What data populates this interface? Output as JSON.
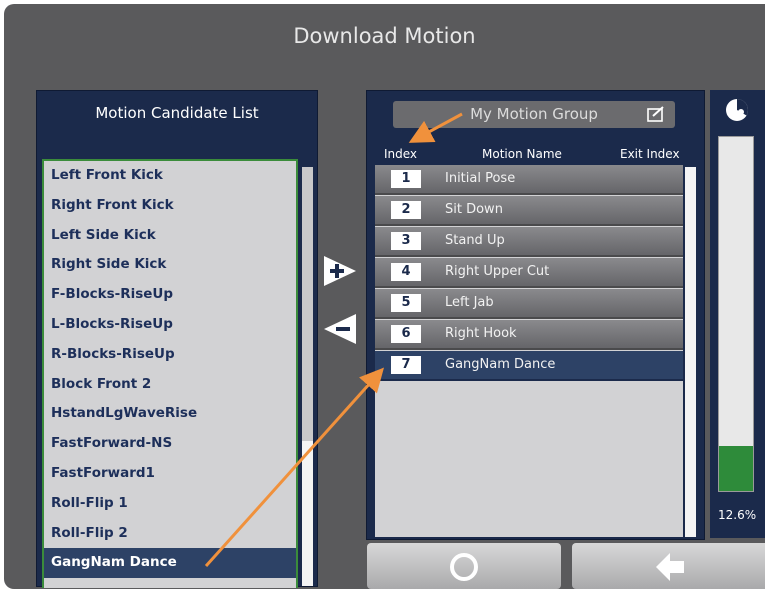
{
  "window": {
    "title": "Download Motion"
  },
  "candidate_panel": {
    "title": "Motion Candidate List",
    "items": [
      "Left Front Kick",
      "Right Front Kick",
      "Left Side Kick",
      "Right Side Kick",
      "F-Blocks-RiseUp",
      "L-Blocks-RiseUp",
      "R-Blocks-RiseUp",
      "Block Front 2",
      "HstandLgWaveRise",
      "FastForward-NS",
      "FastForward1",
      "Roll-Flip 1",
      "Roll-Flip 2",
      "GangNam Dance"
    ],
    "selected_index": 13
  },
  "transfer": {
    "add_icon": "plus-chevron-icon",
    "remove_icon": "minus-chevron-icon"
  },
  "group_panel": {
    "button_label": "My Motion Group",
    "edit_icon": "edit-icon",
    "headers": {
      "index": "Index",
      "name": "Motion Name",
      "exit": "Exit Index"
    },
    "rows": [
      {
        "index": "1",
        "name": "Initial Pose"
      },
      {
        "index": "2",
        "name": "Sit Down"
      },
      {
        "index": "3",
        "name": "Stand Up"
      },
      {
        "index": "4",
        "name": "Right Upper Cut"
      },
      {
        "index": "5",
        "name": "Left Jab"
      },
      {
        "index": "6",
        "name": "Right Hook"
      },
      {
        "index": "7",
        "name": "GangNam Dance"
      }
    ],
    "selected_row": 6
  },
  "memory": {
    "icon": "pie-chart-icon",
    "percent_label": "12.6%",
    "fill_percent": 12.6
  },
  "bottom_buttons": {
    "confirm_icon": "circle-icon",
    "back_icon": "back-arrow-icon"
  },
  "colors": {
    "panel": "#1b2a4b",
    "selection": "#2d4266",
    "gauge_fill": "#2e8b3a",
    "annotation_arrow": "#f0913c"
  }
}
